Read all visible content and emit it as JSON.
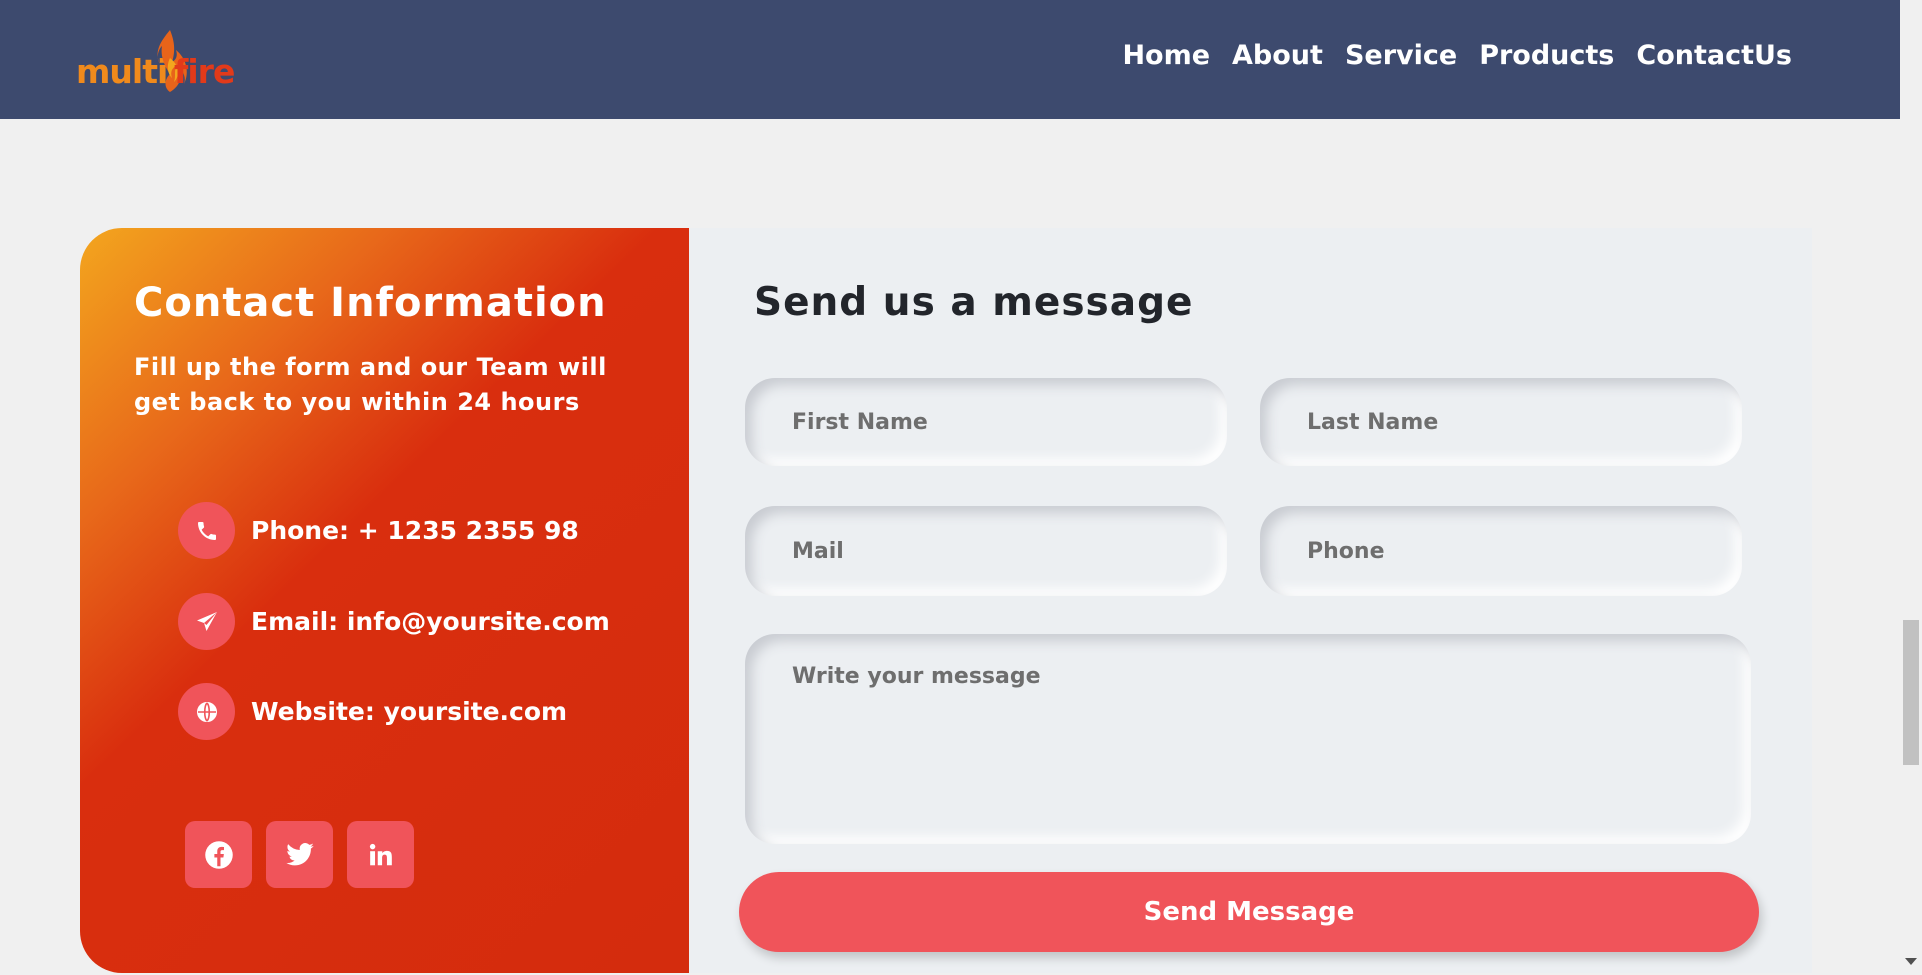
{
  "brand": {
    "logo_part1": "multi",
    "logo_part2": "fire"
  },
  "nav": {
    "items": [
      "Home",
      "About",
      "Service",
      "Products",
      "ContactUs"
    ]
  },
  "contact_info": {
    "title": "Contact Information",
    "subtitle": "Fill up the form and our Team will get back to you within 24 hours",
    "phone": "Phone: + 1235 2355 98",
    "email": "Email: info@yoursite.com",
    "website": "Website: yoursite.com",
    "icons": [
      "phone-icon",
      "paper-plane-icon",
      "globe-icon"
    ],
    "social": [
      "facebook-icon",
      "twitter-icon",
      "linkedin-icon"
    ]
  },
  "form": {
    "title": "Send us a message",
    "first_name_placeholder": "First Name",
    "last_name_placeholder": "Last Name",
    "mail_placeholder": "Mail",
    "phone_placeholder": "Phone",
    "message_placeholder": "Write your message",
    "submit_label": "Send Message"
  },
  "colors": {
    "navbar": "#3d4a6e",
    "accent": "#f0545a",
    "gradient_start": "#f3a61e",
    "gradient_end": "#d42c0d",
    "form_bg": "#eceff2",
    "page_bg": "#f0f0f0"
  }
}
